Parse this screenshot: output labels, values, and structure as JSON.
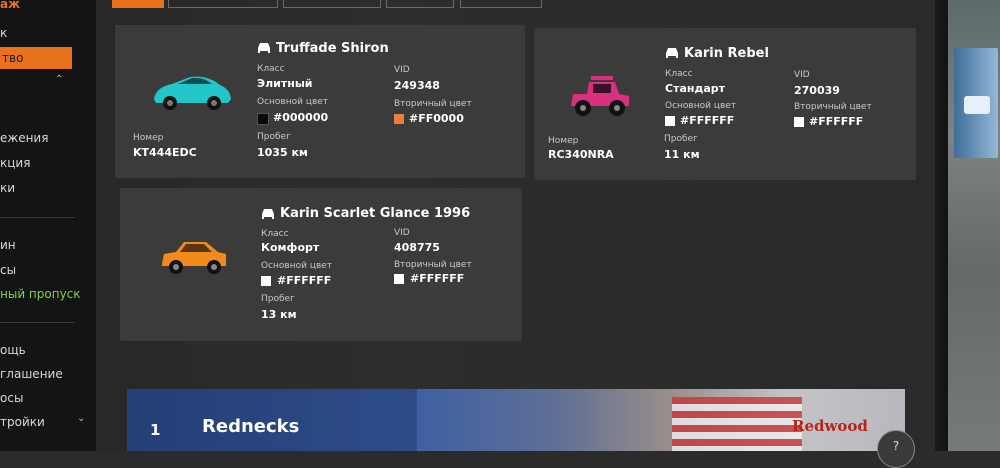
{
  "sidebar": {
    "items": [
      {
        "label": "аж",
        "style": "accent"
      },
      {
        "label": "к",
        "style": "normal"
      },
      {
        "label": "тво",
        "style": "highlight"
      },
      {
        "label": "",
        "style": "normal"
      },
      {
        "label": "ежения",
        "style": "normal"
      },
      {
        "label": "кция",
        "style": "normal"
      },
      {
        "label": "ки",
        "style": "normal"
      },
      {
        "label": "ин",
        "style": "normal"
      },
      {
        "label": "сы",
        "style": "normal"
      },
      {
        "label": "ный пропуск",
        "style": "green"
      },
      {
        "label": "ощь",
        "style": "normal"
      },
      {
        "label": "глашение",
        "style": "normal"
      },
      {
        "label": "осы",
        "style": "normal"
      },
      {
        "label": "тройки",
        "style": "normal"
      }
    ]
  },
  "labels": {
    "class": "Класс",
    "vid": "VID",
    "primary_color": "Основной цвет",
    "secondary_color": "Вторичный цвет",
    "mileage": "Пробег",
    "plate": "Номер"
  },
  "vehicles": [
    {
      "name": "Truffade Shiron",
      "class": "Элитный",
      "vid": "249348",
      "primary_color": "#000000",
      "secondary_color": "#FF0000",
      "primary_swatch": "#0a0a0a",
      "secondary_swatch": "#ef7d3c",
      "mileage": "1035 км",
      "plate": "KT444EDC",
      "car_color": "#22c6c9"
    },
    {
      "name": "Karin Rebel",
      "class": "Стандарт",
      "vid": "270039",
      "primary_color": "#FFFFFF",
      "secondary_color": "#FFFFFF",
      "primary_swatch": "#ffffff",
      "secondary_swatch": "#ffffff",
      "mileage": "11 км",
      "plate": "RC340NRA",
      "car_color": "#d9307e"
    },
    {
      "name": "Karin Scarlet Glance 1996",
      "class": "Комфорт",
      "vid": "408775",
      "primary_color": "#FFFFFF",
      "secondary_color": "#FFFFFF",
      "primary_swatch": "#ffffff",
      "secondary_swatch": "#ffffff",
      "mileage": "13 км",
      "plate": "",
      "car_color": "#f28a1a"
    }
  ],
  "banner": {
    "rank": "1",
    "name": "Rednecks",
    "brand": "Redwood"
  },
  "help": {
    "icon": "help-icon",
    "label": "?"
  },
  "colors": {
    "accent": "#e8721b",
    "card": "#3b3b3b",
    "green": "#7cd34a"
  }
}
